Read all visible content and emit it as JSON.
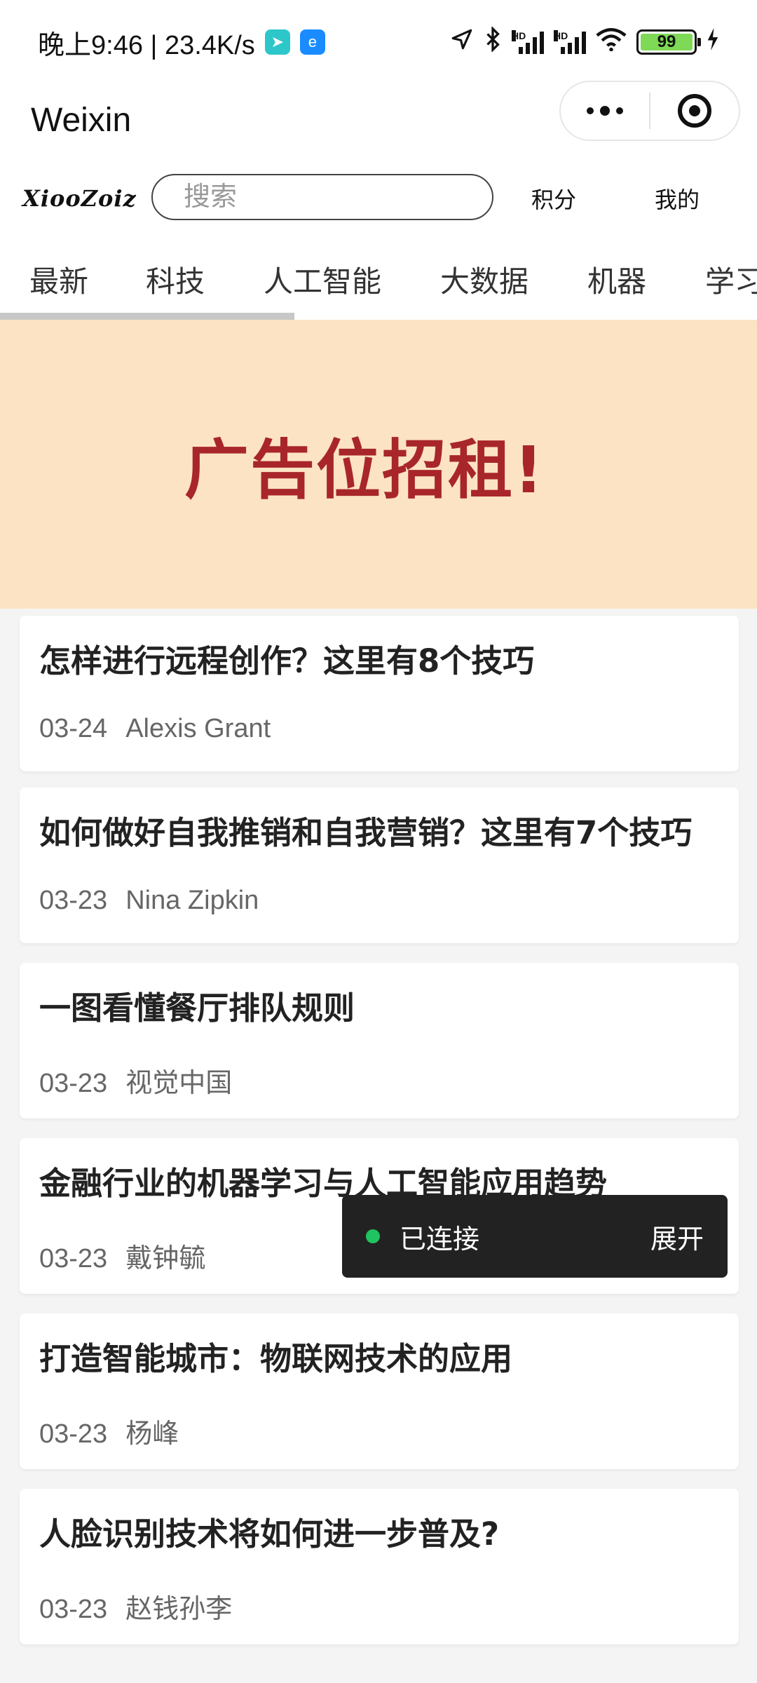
{
  "status_bar": {
    "time_speed": "晚上9:46 | 23.4K/s",
    "hd_label": "HD",
    "battery_level": "99",
    "icons": [
      "telegram-icon",
      "browser-icon",
      "location-arrow-icon",
      "bluetooth-icon",
      "signal-icon",
      "signal-icon",
      "wifi-icon",
      "battery-icon",
      "charging-icon"
    ]
  },
  "title_bar": {
    "title": "Weixin",
    "menu_icon": "more-dots-icon",
    "close_icon": "target-circle-icon"
  },
  "header": {
    "logo_text": "XiooZoiz",
    "search_placeholder": "搜索",
    "points_label": "积分",
    "mine_label": "我的"
  },
  "tabs": [
    {
      "label": "最新"
    },
    {
      "label": "科技"
    },
    {
      "label": "人工智能"
    },
    {
      "label": "大数据"
    },
    {
      "label": "机器"
    },
    {
      "label": "学习"
    }
  ],
  "banner": {
    "text": "广告位招租!",
    "background": "#fce3c4",
    "text_color": "#a8262a"
  },
  "articles": [
    {
      "title": "怎样进行远程创作？这里有8个技巧",
      "date": "03-24",
      "author": "Alexis Grant"
    },
    {
      "title": "如何做好自我推销和自我营销？这里有7个技巧",
      "date": "03-23",
      "author": "Nina Zipkin"
    },
    {
      "title": "一图看懂餐厅排队规则",
      "date": "03-23",
      "author": "视觉中国"
    },
    {
      "title": "金融行业的机器学习与人工智能应用趋势",
      "date": "03-23",
      "author": "戴钟毓"
    },
    {
      "title": "打造智能城市：物联网技术的应用",
      "date": "03-23",
      "author": "杨峰"
    },
    {
      "title": "人脸识别技术将如何进一步普及?",
      "date": "03-23",
      "author": "赵钱孙李"
    }
  ],
  "float_pill": {
    "status": "已连接",
    "action": "展开",
    "dot_color": "#1fc35f"
  }
}
